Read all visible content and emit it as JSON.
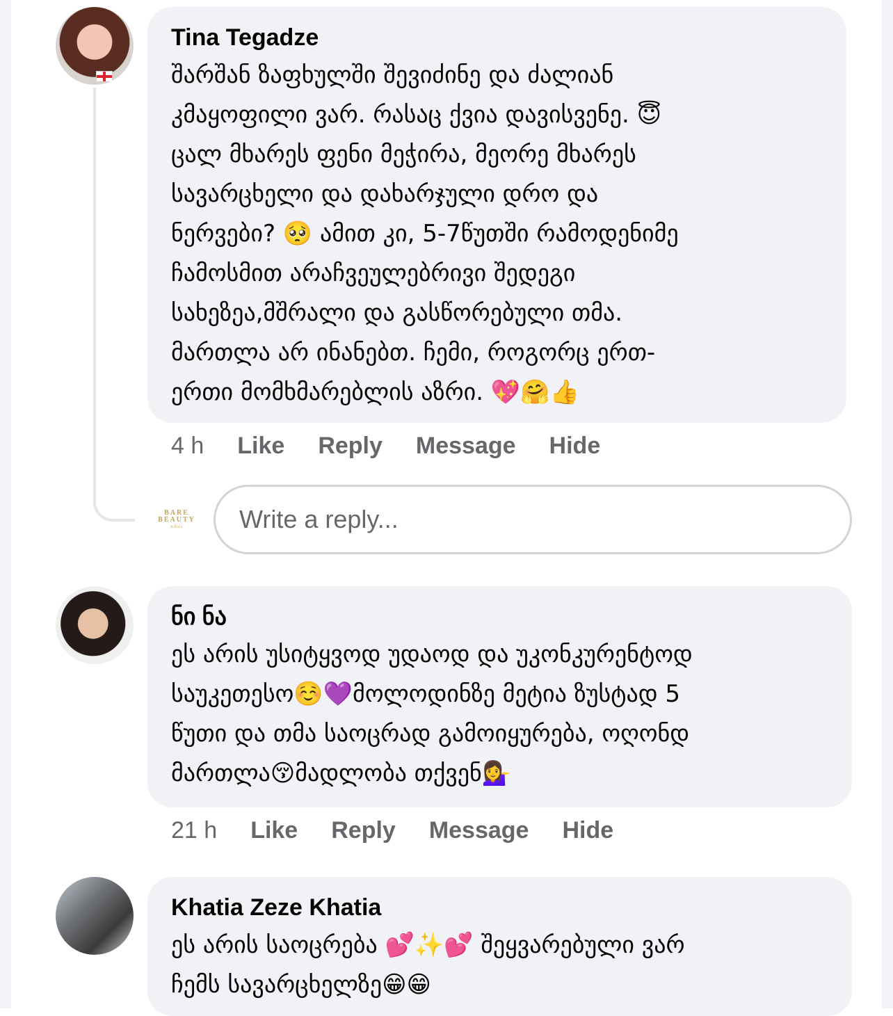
{
  "comments": [
    {
      "author": "Tina Tegadze",
      "text": "შარშან ზაფხულში შევიძინე და ძალიან\nკმაყოფილი ვარ. რასაც ქვია დავისვენე. 😇\nცალ მხარეს ფენი მეჭირა, მეორე მხარეს\nსავარცხელი და დახარჯული დრო და\nნერვები? 🥺 ამით კი, 5-7წუთში რამოდენიმე\nჩამოსმით არაჩვეულებრივი შედეგი\nსახეზეა,მშრალი და გასწორებული თმა.\nმართლა არ ინანებთ. ჩემი, როგორც ერთ-\nერთი მომხმარებლის აზრი. 💖🤗👍",
      "time": "4 h",
      "actions": {
        "like": "Like",
        "reply": "Reply",
        "message": "Message",
        "hide": "Hide"
      }
    },
    {
      "author": "ნი ნა",
      "text": "ეს არის უსიტყვოდ უდაოდ და უკონკურენტოდ\nსაუკეთესო☺️💜მოლოდინზე მეტია ზუსტად 5\nწუთი და თმა საოცრად გამოიყურება, ოღონდ\nმართლა😚მადლობა თქვენ💁‍♀️",
      "time": "21 h",
      "actions": {
        "like": "Like",
        "reply": "Reply",
        "message": "Message",
        "hide": "Hide"
      }
    },
    {
      "author": "Khatia Zeze Khatia",
      "text": "ეს არის საოცრება 💕✨💕 შეყვარებული ვარ\nჩემს სავარცხელზე😁😁"
    }
  ],
  "reply_box": {
    "placeholder": "Write a reply...",
    "logo_line1": "BARE",
    "logo_line2": "BEAUTY",
    "logo_line3": "Adult"
  }
}
